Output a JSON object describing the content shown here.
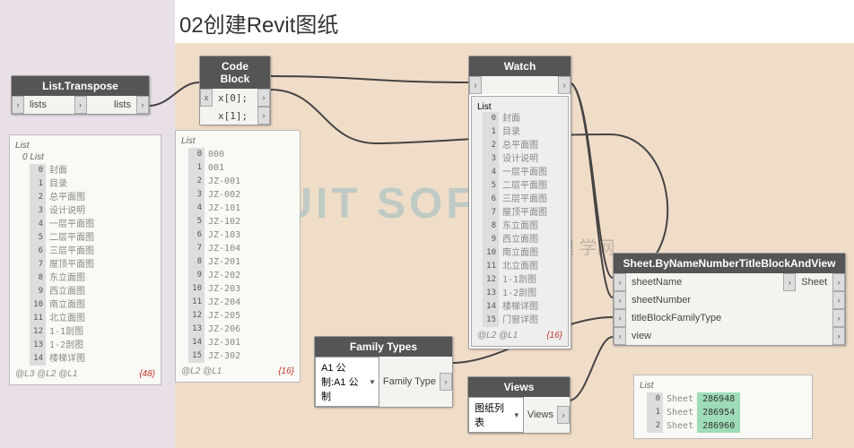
{
  "title": "02创建Revit图纸",
  "nodes": {
    "transpose": {
      "header": "List.Transpose",
      "in": "lists",
      "out": "lists"
    },
    "codeblock": {
      "header": "Code Block",
      "in": "x",
      "lines": [
        "x[0];",
        "x[1];"
      ]
    },
    "watch": {
      "header": "Watch"
    },
    "familyTypes": {
      "header": "Family Types",
      "value": "A1 公制:A1 公制",
      "out": "Family Type"
    },
    "views": {
      "header": "Views",
      "value": "图纸列表",
      "out": "Views"
    },
    "sheet": {
      "header": "Sheet.ByNameNumberTitleBlockAndView",
      "ports": [
        "sheetName",
        "sheetNumber",
        "titleBlockFamilyType",
        "view"
      ],
      "out": "Sheet"
    }
  },
  "preview1": {
    "header": "List",
    "sub": "0 List",
    "items": [
      {
        "i": "0",
        "v": "封面"
      },
      {
        "i": "1",
        "v": "目录"
      },
      {
        "i": "2",
        "v": "总平面图"
      },
      {
        "i": "3",
        "v": "设计说明"
      },
      {
        "i": "4",
        "v": "一层平面图"
      },
      {
        "i": "5",
        "v": "二层平面图"
      },
      {
        "i": "6",
        "v": "三层平面图"
      },
      {
        "i": "7",
        "v": "屋顶平面图"
      },
      {
        "i": "8",
        "v": "东立面图"
      },
      {
        "i": "9",
        "v": "西立面图"
      },
      {
        "i": "10",
        "v": "南立面图"
      },
      {
        "i": "11",
        "v": "北立面图"
      },
      {
        "i": "12",
        "v": "1-1剖图"
      },
      {
        "i": "13",
        "v": "1-2剖图"
      },
      {
        "i": "14",
        "v": "楼梯详图"
      }
    ],
    "level": "@L3 @L2 @L1",
    "count": "{48}"
  },
  "preview2": {
    "header": "List",
    "items": [
      {
        "i": "0",
        "v": "000"
      },
      {
        "i": "1",
        "v": "001"
      },
      {
        "i": "2",
        "v": "JZ-001"
      },
      {
        "i": "3",
        "v": "JZ-002"
      },
      {
        "i": "4",
        "v": "JZ-101"
      },
      {
        "i": "5",
        "v": "JZ-102"
      },
      {
        "i": "6",
        "v": "JZ-103"
      },
      {
        "i": "7",
        "v": "JZ-104"
      },
      {
        "i": "8",
        "v": "JZ-201"
      },
      {
        "i": "9",
        "v": "JZ-202"
      },
      {
        "i": "10",
        "v": "JZ-203"
      },
      {
        "i": "11",
        "v": "JZ-204"
      },
      {
        "i": "12",
        "v": "JZ-205"
      },
      {
        "i": "13",
        "v": "JZ-206"
      },
      {
        "i": "14",
        "v": "JZ-301"
      },
      {
        "i": "15",
        "v": "JZ-302"
      }
    ],
    "level": "@L2 @L1",
    "count": "{16}"
  },
  "watchData": {
    "header": "List",
    "items": [
      {
        "i": "0",
        "v": "封面"
      },
      {
        "i": "1",
        "v": "目录"
      },
      {
        "i": "2",
        "v": "总平面图"
      },
      {
        "i": "3",
        "v": "设计说明"
      },
      {
        "i": "4",
        "v": "一层平面图"
      },
      {
        "i": "5",
        "v": "二层平面图"
      },
      {
        "i": "6",
        "v": "三层平面图"
      },
      {
        "i": "7",
        "v": "屋顶平面图"
      },
      {
        "i": "8",
        "v": "东立面图"
      },
      {
        "i": "9",
        "v": "西立面图"
      },
      {
        "i": "10",
        "v": "南立面图"
      },
      {
        "i": "11",
        "v": "北立面图"
      },
      {
        "i": "12",
        "v": "1-1剖图"
      },
      {
        "i": "13",
        "v": "1-2剖图"
      },
      {
        "i": "14",
        "v": "楼梯详图"
      },
      {
        "i": "15",
        "v": "门窗详图"
      }
    ],
    "level": "@L2 @L1",
    "count": "{16}"
  },
  "sheetPreview": {
    "header": "List",
    "items": [
      {
        "i": "0",
        "l": "Sheet",
        "v": "286948"
      },
      {
        "i": "1",
        "l": "Sheet",
        "v": "286954"
      },
      {
        "i": "2",
        "l": "Sheet",
        "v": "286960"
      }
    ]
  },
  "watermark": "TUIT  SOFT",
  "watermark2": "腿腿    学网"
}
